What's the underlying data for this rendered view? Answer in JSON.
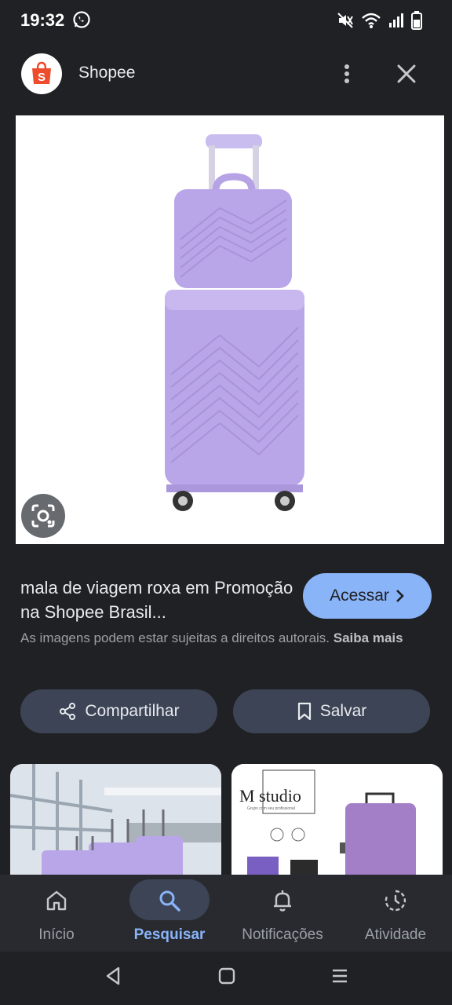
{
  "status_bar": {
    "time": "19:32",
    "icons": [
      "whatsapp-icon",
      "mute-icon",
      "wifi-icon",
      "signal-icon",
      "battery-icon"
    ]
  },
  "header": {
    "site_name": "Shopee",
    "logo_icon": "shopee-bag-icon",
    "menu_icon": "more-vert-icon",
    "close_icon": "close-icon"
  },
  "result": {
    "image_subject": "purple-luggage-set",
    "title": "mala de viagem roxa em Promoção na Shopee Brasil...",
    "visit_label": "Acessar",
    "copyright_text": "As imagens podem estar sujeitas a direitos autorais.",
    "learn_more": "Saiba mais"
  },
  "actions": {
    "share_label": "Compartilhar",
    "save_label": "Salvar"
  },
  "related": {
    "thumb2_brand": "M studio",
    "thumb2_tagline": "Grupo com seu profissional"
  },
  "bottom_nav": {
    "items": [
      {
        "label": "Início",
        "icon": "home-icon"
      },
      {
        "label": "Pesquisar",
        "icon": "search-icon",
        "active": true
      },
      {
        "label": "Notificações",
        "icon": "bell-icon"
      },
      {
        "label": "Atividade",
        "icon": "activity-icon"
      }
    ]
  },
  "colors": {
    "background": "#202124",
    "accent": "#8ab4f8",
    "pill": "#3c4455",
    "luggage": "#b9a6e8"
  }
}
